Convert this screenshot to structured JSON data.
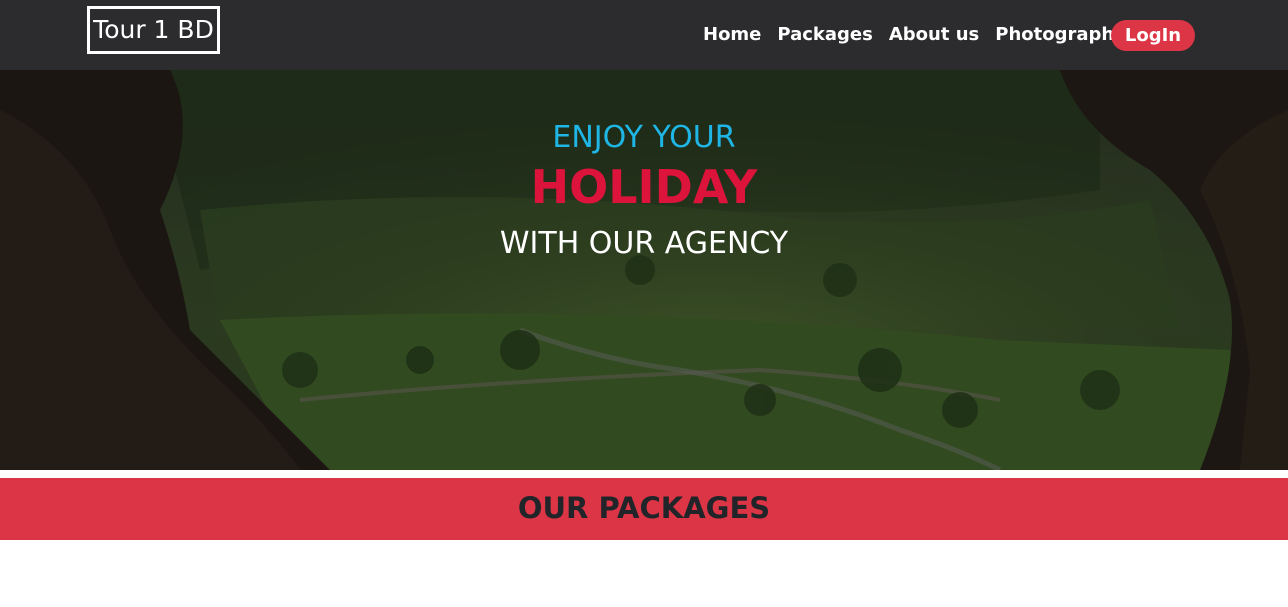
{
  "navbar": {
    "brand": "Tour 1 BD",
    "links": [
      "Home",
      "Packages",
      "About us",
      "Photograph"
    ],
    "login_label": "LogIn",
    "background_color": "#2c2c2e"
  },
  "hero": {
    "line1": "ENJOY YOUR",
    "line2": "HOLIDAY",
    "line3": "WITH OUR AGENCY",
    "line1_color": "#1fb6e6",
    "line2_color": "#dc143c",
    "line3_color": "#ffffff",
    "background_image": "cave-opening-valley-landscape"
  },
  "packages": {
    "title": "OUR PACKAGES",
    "banner_color": "#dc3545"
  }
}
